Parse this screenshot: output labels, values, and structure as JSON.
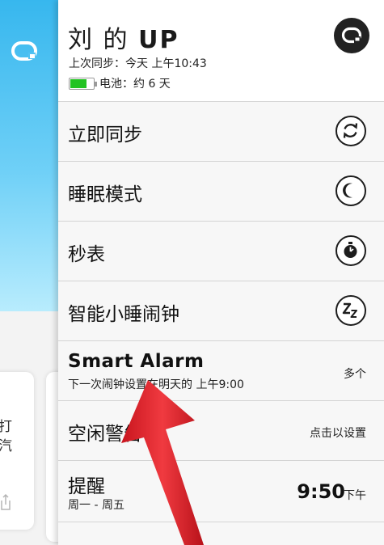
{
  "background_app": {
    "card_text_line1": "打",
    "card_text_line2": "汽"
  },
  "header": {
    "title_prefix": "刘 的",
    "title_device": "UP",
    "last_sync": "上次同步：今天 上午10:43",
    "battery_text": "电池：约 6 天",
    "battery_level_percent": 70
  },
  "menu": {
    "sync_now": "立即同步",
    "sleep_mode": "睡眠模式",
    "stopwatch": "秒表",
    "power_nap": "智能小睡闹钟",
    "smart_alarm": {
      "title": "Smart Alarm",
      "subtitle": "下一次闹钟设置在明天的 上午9:00",
      "value": "多个"
    },
    "idle_alert": {
      "label": "空闲警告",
      "value": "点击以设置"
    },
    "reminder": {
      "label": "提醒",
      "subtitle": "周一 - 周五",
      "time": "9:50",
      "ampm": "下午"
    }
  },
  "colors": {
    "accent_blue": "#37b7ee",
    "battery_green": "#22c322",
    "annotation_arrow": "#e8232c"
  },
  "icons": {
    "brand": "up-logo-icon",
    "sync": "sync-icon",
    "sleep": "moon-icon",
    "stopwatch": "stopwatch-icon",
    "nap": "zz-icon"
  }
}
